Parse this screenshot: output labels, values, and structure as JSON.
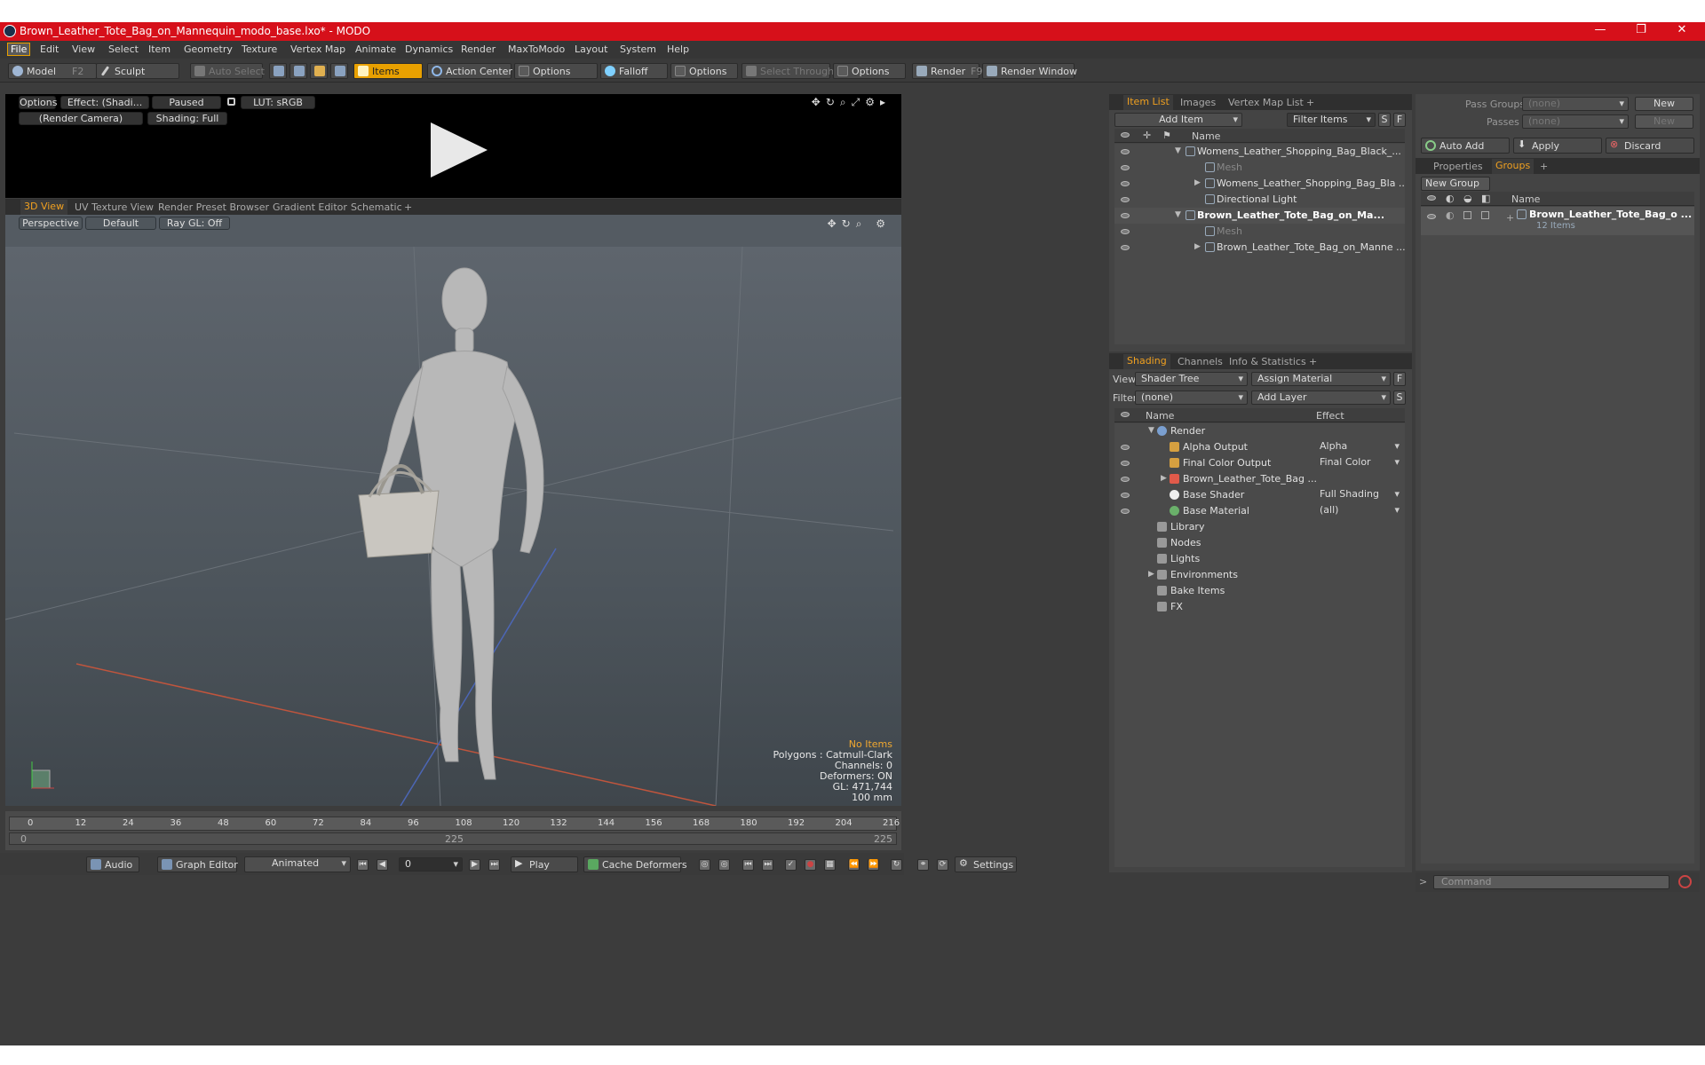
{
  "window": {
    "title": "Brown_Leather_Tote_Bag_on_Mannequin_modo_base.lxo* - MODO",
    "minimize": "—",
    "restore": "❐",
    "close": "✕"
  },
  "menu": [
    "File",
    "Edit",
    "View",
    "Select",
    "Item",
    "Geometry",
    "Texture",
    "Vertex Map",
    "Animate",
    "Dynamics",
    "Render",
    "MaxToModo",
    "Layout",
    "System",
    "Help"
  ],
  "toolbar": {
    "model": "Model",
    "model_key": "F2",
    "sculpt": "Sculpt",
    "auto_select": "Auto Select",
    "items": "Items",
    "action_center": "Action Center",
    "options1": "Options",
    "falloff": "Falloff",
    "options2": "Options",
    "select_through": "Select Through",
    "options3": "Options",
    "render": "Render",
    "render_key": "F9",
    "render_window": "Render Window"
  },
  "preview": {
    "options": "Options",
    "effect": "Effect: (Shadi...",
    "paused": "Paused",
    "lut": "LUT: sRGB",
    "camera": "(Render Camera)",
    "shading": "Shading: Full"
  },
  "viewport_tabs": [
    "3D View",
    "UV Texture View",
    "Render Preset Browser",
    "Gradient Editor",
    "Schematic",
    "+"
  ],
  "viewport": {
    "perspective": "Perspective",
    "default": "Default",
    "raygl": "Ray GL: Off",
    "no_items": "No Items",
    "polygons": "Polygons : Catmull-Clark",
    "channels": "Channels: 0",
    "deformers": "Deformers: ON",
    "gl": "GL: 471,744",
    "scale": "100 mm"
  },
  "timeline": {
    "ticks": [
      "0",
      "12",
      "24",
      "36",
      "48",
      "60",
      "72",
      "84",
      "96",
      "108",
      "120",
      "132",
      "144",
      "156",
      "168",
      "180",
      "192",
      "204",
      "216"
    ],
    "start": "0",
    "mid": "225",
    "end": "225"
  },
  "bottom": {
    "audio": "Audio",
    "graph_editor": "Graph Editor",
    "animated": "Animated",
    "frame": "0",
    "play": "Play",
    "cache": "Cache Deformers",
    "settings": "Settings"
  },
  "item_list": {
    "tabs": [
      "Item List",
      "Images",
      "Vertex Map List",
      "+"
    ],
    "add_item": "Add Item",
    "filter": "Filter Items",
    "s": "S",
    "f": "F",
    "col_name": "Name",
    "rows": [
      {
        "label": "Womens_Leather_Shopping_Bag_Black_...",
        "bold": false,
        "level": 0,
        "arrow": "▼"
      },
      {
        "label": "Mesh",
        "bold": false,
        "level": 1,
        "arrow": "",
        "dim": true
      },
      {
        "label": "Womens_Leather_Shopping_Bag_Bla ...",
        "bold": false,
        "level": 1,
        "arrow": "▶"
      },
      {
        "label": "Directional Light",
        "bold": false,
        "level": 1,
        "arrow": ""
      },
      {
        "label": "Brown_Leather_Tote_Bag_on_Ma...",
        "bold": true,
        "level": 0,
        "arrow": "▼"
      },
      {
        "label": "Mesh",
        "bold": false,
        "level": 1,
        "arrow": "",
        "dim": true
      },
      {
        "label": "Brown_Leather_Tote_Bag_on_Manne ...",
        "bold": false,
        "level": 1,
        "arrow": "▶"
      }
    ]
  },
  "shading": {
    "tabs": [
      "Shading",
      "Channels",
      "Info & Statistics",
      "+"
    ],
    "view_label": "View",
    "view_value": "Shader Tree",
    "assign": "Assign Material",
    "f": "F",
    "filter_label": "Filter",
    "filter_value": "(none)",
    "add_layer": "Add Layer",
    "s": "S",
    "col_name": "Name",
    "col_effect": "Effect",
    "rows": [
      {
        "name": "Render",
        "effect": "",
        "arrow": "▼",
        "indent": 0
      },
      {
        "name": "Alpha Output",
        "effect": "Alpha",
        "arrow": "",
        "indent": 1
      },
      {
        "name": "Final Color Output",
        "effect": "Final Color",
        "arrow": "",
        "indent": 1
      },
      {
        "name": "Brown_Leather_Tote_Bag ...",
        "effect": "",
        "arrow": "▶",
        "indent": 1
      },
      {
        "name": "Base Shader",
        "effect": "Full Shading",
        "arrow": "",
        "indent": 1
      },
      {
        "name": "Base Material",
        "effect": "(all)",
        "arrow": "",
        "indent": 1
      },
      {
        "name": "Library",
        "effect": "",
        "arrow": "",
        "indent": 0
      },
      {
        "name": "Nodes",
        "effect": "",
        "arrow": "",
        "indent": 0
      },
      {
        "name": "Lights",
        "effect": "",
        "arrow": "",
        "indent": 0
      },
      {
        "name": "Environments",
        "effect": "",
        "arrow": "▶",
        "indent": 0
      },
      {
        "name": "Bake Items",
        "effect": "",
        "arrow": "",
        "indent": 0
      },
      {
        "name": "FX",
        "effect": "",
        "arrow": "",
        "indent": 0
      }
    ]
  },
  "groups": {
    "pass_groups": "Pass Groups",
    "pass_groups_value": "(none)",
    "new": "New",
    "passes": "Passes",
    "passes_value": "(none)",
    "new2": "New",
    "auto_add": "Auto Add",
    "apply": "Apply",
    "discard": "Discard",
    "tabs": [
      "Properties",
      "Groups",
      "+"
    ],
    "new_group": "New Group",
    "col_name": "Name",
    "group_name": "Brown_Leather_Tote_Bag_o ...",
    "group_count": "12 Items"
  },
  "command": {
    "placeholder": "Command"
  }
}
